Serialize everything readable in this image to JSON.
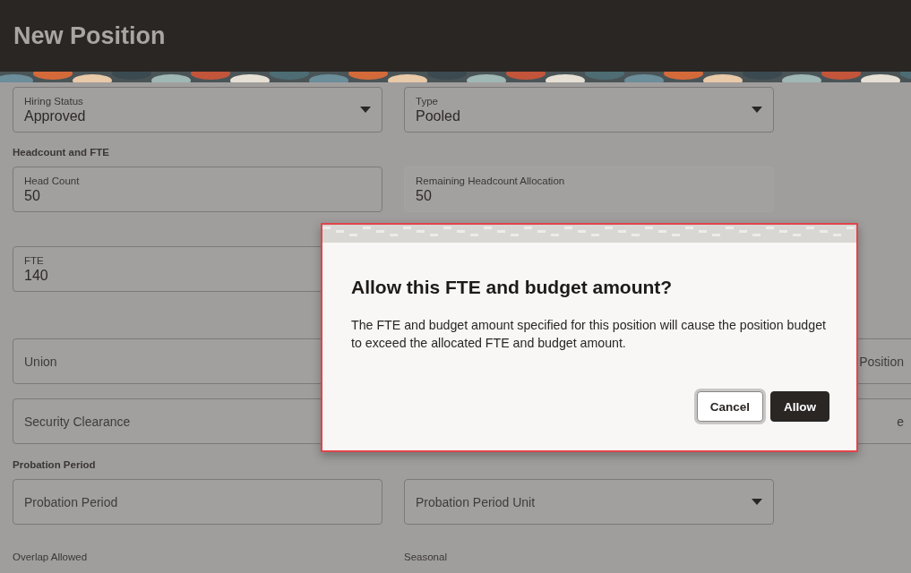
{
  "header": {
    "title": "New Position"
  },
  "form": [
    {
      "kind": "row",
      "fields": [
        {
          "kind": "select",
          "label": "Hiring Status",
          "value": "Approved"
        },
        {
          "kind": "select",
          "label": "Type",
          "value": "Pooled"
        }
      ]
    },
    {
      "kind": "heading",
      "text": "Headcount and FTE"
    },
    {
      "kind": "row",
      "fields": [
        {
          "kind": "input",
          "label": "Head Count",
          "value": "50"
        },
        {
          "kind": "readonly",
          "label": "Remaining Headcount Allocation",
          "value": "50"
        }
      ]
    },
    {
      "kind": "row",
      "fields": [
        {
          "kind": "input",
          "label": "FTE",
          "value": "140"
        }
      ]
    },
    {
      "kind": "row",
      "fields": [
        {
          "kind": "input",
          "placeholder": "Union"
        },
        {
          "kind": "clipped",
          "placeholder": "Position"
        }
      ]
    },
    {
      "kind": "row",
      "fields": [
        {
          "kind": "input",
          "placeholder": "Security Clearance"
        },
        {
          "kind": "clipped",
          "placeholder": "e"
        }
      ]
    },
    {
      "kind": "heading",
      "text": "Probation Period"
    },
    {
      "kind": "row",
      "fields": [
        {
          "kind": "input",
          "placeholder": "Probation Period"
        },
        {
          "kind": "select",
          "placeholder": "Probation Period Unit"
        }
      ]
    },
    {
      "kind": "labels",
      "texts": [
        "Overlap Allowed",
        "Seasonal"
      ]
    }
  ],
  "dialog": {
    "title": "Allow this FTE and budget amount?",
    "message": "The FTE and budget amount specified for this position will cause the position budget to exceed the allocated FTE and budget amount.",
    "buttons": [
      {
        "kind": "secondary",
        "label": "Cancel",
        "focused": true
      },
      {
        "kind": "primary",
        "label": "Allow",
        "focused": false
      }
    ]
  }
}
